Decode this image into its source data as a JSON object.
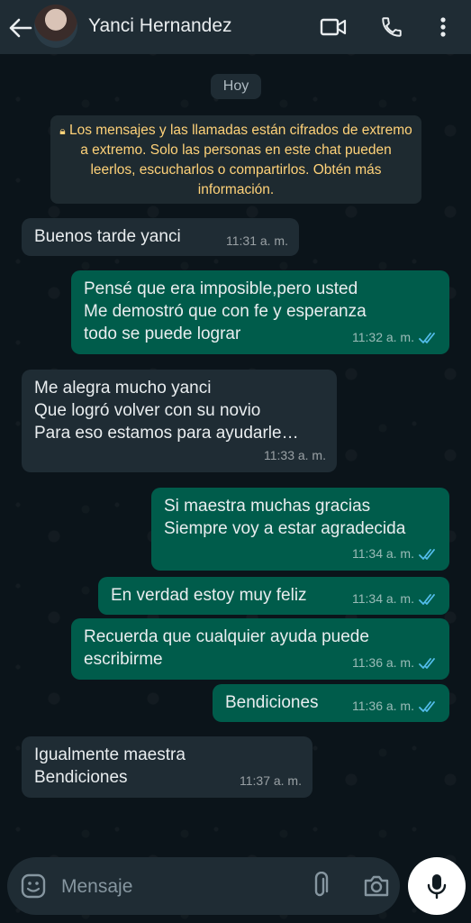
{
  "header": {
    "contact_name": "Yanci Hernandez",
    "icons": [
      "back-arrow-icon",
      "avatar",
      "video-call-icon",
      "phone-icon",
      "more-vert-icon"
    ]
  },
  "chat": {
    "date_chip": "Hoy",
    "encryption_notice": "Los mensajes y las llamadas están cifrados de extremo a extremo. Solo las personas en este chat pueden leerlos, escucharlos o compartirlos. Obtén más información.",
    "messages": [
      {
        "direction": "in",
        "text": "Buenos tarde yanci",
        "time": "11:31 a. m."
      },
      {
        "direction": "out",
        "text": "Pensé que  era imposible,pero  usted\nMe demostró  que  con fe y esperanza\ntodo se puede lograr",
        "time": "11:32 a. m.",
        "status": "read"
      },
      {
        "direction": "in",
        "text": "Me alegra mucho yanci\nQue logró volver con su novio\nPara eso estamos para ayudarle…",
        "time": "11:33 a. m."
      },
      {
        "direction": "out",
        "text": "Si maestra  muchas gracias\nSiempre voy a estar agradecida",
        "time": "11:34 a. m.",
        "status": "read"
      },
      {
        "direction": "out",
        "text": "En verdad estoy muy feliz",
        "time": "11:34 a. m.",
        "status": "read"
      },
      {
        "direction": "out",
        "text": "Recuerda  que  cualquier  ayuda puede\nescribirme",
        "time": "11:36 a. m.",
        "status": "read"
      },
      {
        "direction": "out",
        "text": "Bendiciones",
        "time": "11:36 a. m.",
        "status": "read"
      },
      {
        "direction": "in",
        "text": "Igualmente maestra\nBendiciones",
        "time": "11:37 a. m."
      }
    ]
  },
  "composer": {
    "placeholder": "Mensaje",
    "icons": [
      "emoji-icon",
      "attach-icon",
      "camera-icon",
      "mic-icon"
    ]
  },
  "colors": {
    "background": "#0b141a",
    "header": "#1f2c34",
    "incoming_bubble": "#1f2c34",
    "outgoing_bubble": "#005c4b",
    "read_ticks": "#53bdeb",
    "encryption_text": "#ffd279"
  }
}
